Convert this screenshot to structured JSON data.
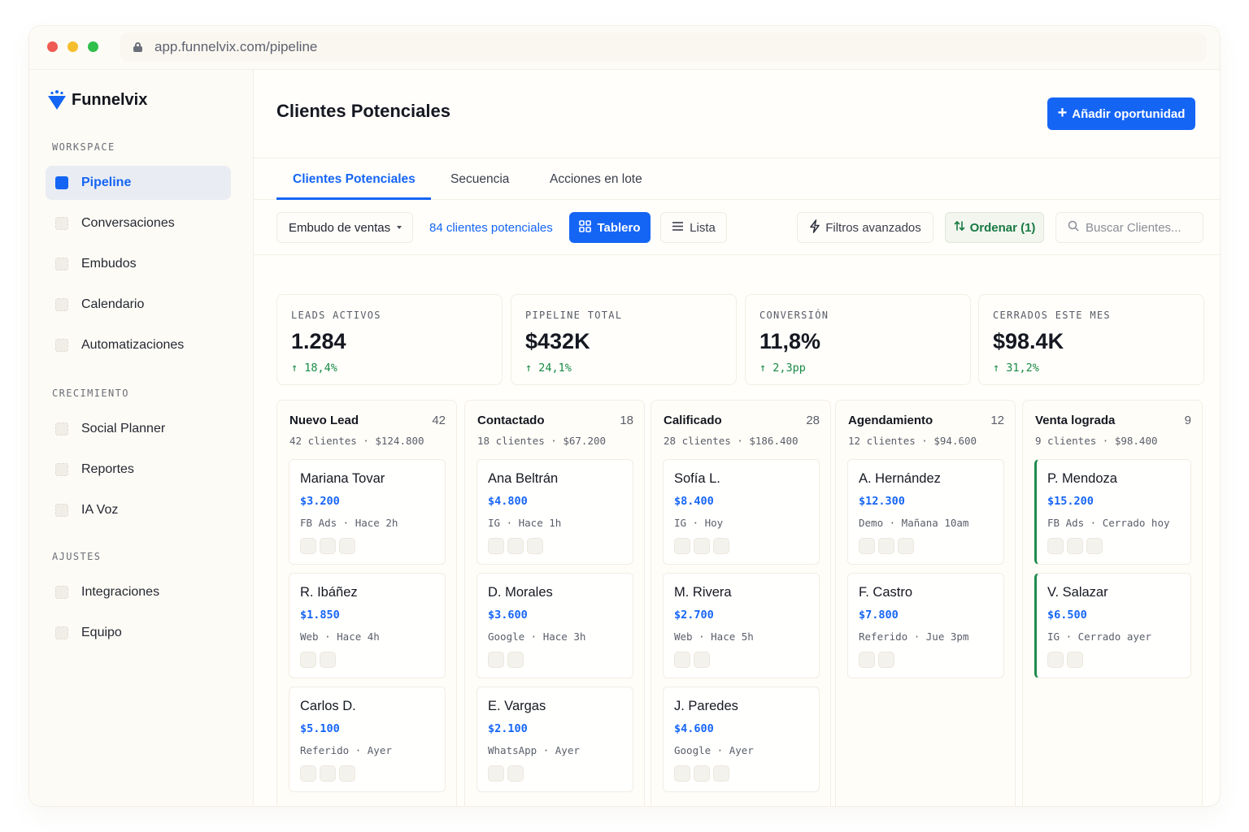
{
  "browser": {
    "url": "app.funnelvix.com/pipeline"
  },
  "brand": {
    "name": "Funnelvix",
    "color": "#1565f5"
  },
  "sidebar": {
    "sections": [
      {
        "label": "WORKSPACE",
        "items": [
          {
            "label": "Pipeline",
            "icon": "pipeline-icon",
            "active": true
          },
          {
            "label": "Conversaciones",
            "icon": "chat-icon"
          },
          {
            "label": "Embudos",
            "icon": "funnel-icon"
          },
          {
            "label": "Calendario",
            "icon": "calendar-icon"
          },
          {
            "label": "Automatizaciones",
            "icon": "automation-icon"
          }
        ]
      },
      {
        "label": "CRECIMIENTO",
        "items": [
          {
            "label": "Social Planner",
            "icon": "social-icon"
          },
          {
            "label": "Reportes",
            "icon": "reports-icon"
          },
          {
            "label": "IA Voz",
            "icon": "voice-icon"
          }
        ]
      },
      {
        "label": "AJUSTES",
        "items": [
          {
            "label": "Integraciones",
            "icon": "integrations-icon"
          },
          {
            "label": "Equipo",
            "icon": "team-icon"
          }
        ]
      }
    ]
  },
  "header": {
    "title": "Clientes Potenciales",
    "add_button": "Añadir oportunidad"
  },
  "tabs": [
    {
      "label": "Clientes Potenciales",
      "active": true
    },
    {
      "label": "Secuencia"
    },
    {
      "label": "Acciones en lote"
    }
  ],
  "toolbar": {
    "pipeline_select": "Embudo de ventas",
    "lead_count": "84 clientes potenciales",
    "board_label": "Tablero",
    "list_label": "Lista",
    "filters_label": "Filtros avanzados",
    "sort_label": "Ordenar (1)",
    "search_placeholder": "Buscar Clientes..."
  },
  "kpis": [
    {
      "label": "LEADS ACTIVOS",
      "value": "1.284",
      "delta": "18,4%"
    },
    {
      "label": "PIPELINE TOTAL",
      "value": "$432K",
      "delta": "24,1%"
    },
    {
      "label": "CONVERSIÓN",
      "value": "11,8%",
      "delta": "2,3pp"
    },
    {
      "label": "CERRADOS ESTE MES",
      "value": "$98.4K",
      "delta": "31,2%"
    }
  ],
  "columns": [
    {
      "title": "Nuevo Lead",
      "count": "42",
      "summary": "42 clientes · $124.800",
      "cards": [
        {
          "name": "Mariana Tovar",
          "amount": "$3.200",
          "meta": "FB Ads · Hace 2h",
          "chips": 3
        },
        {
          "name": "R. Ibáñez",
          "amount": "$1.850",
          "meta": "Web · Hace 4h",
          "chips": 2
        },
        {
          "name": "Carlos D.",
          "amount": "$5.100",
          "meta": "Referido · Ayer",
          "chips": 3
        }
      ]
    },
    {
      "title": "Contactado",
      "count": "18",
      "summary": "18 clientes · $67.200",
      "cards": [
        {
          "name": "Ana Beltrán",
          "amount": "$4.800",
          "meta": "IG · Hace 1h",
          "chips": 3
        },
        {
          "name": "D. Morales",
          "amount": "$3.600",
          "meta": "Google · Hace 3h",
          "chips": 2
        },
        {
          "name": "E. Vargas",
          "amount": "$2.100",
          "meta": "WhatsApp · Ayer",
          "chips": 2
        }
      ]
    },
    {
      "title": "Calificado",
      "count": "28",
      "summary": "28 clientes · $186.400",
      "cards": [
        {
          "name": "Sofía L.",
          "amount": "$8.400",
          "meta": "IG · Hoy",
          "chips": 3
        },
        {
          "name": "M. Rivera",
          "amount": "$2.700",
          "meta": "Web · Hace 5h",
          "chips": 2
        },
        {
          "name": "J. Paredes",
          "amount": "$4.600",
          "meta": "Google · Ayer",
          "chips": 3
        }
      ]
    },
    {
      "title": "Agendamiento",
      "count": "12",
      "summary": "12 clientes · $94.600",
      "cards": [
        {
          "name": "A. Hernández",
          "amount": "$12.300",
          "meta": "Demo · Mañana 10am",
          "chips": 3
        },
        {
          "name": "F. Castro",
          "amount": "$7.800",
          "meta": "Referido · Jue 3pm",
          "chips": 2
        }
      ]
    },
    {
      "title": "Venta lograda",
      "count": "9",
      "summary": "9 clientes · $98.400",
      "won": true,
      "cards": [
        {
          "name": "P. Mendoza",
          "amount": "$15.200",
          "meta": "FB Ads · Cerrado hoy",
          "chips": 3
        },
        {
          "name": "V. Salazar",
          "amount": "$6.500",
          "meta": "IG · Cerrado ayer",
          "chips": 2
        }
      ]
    }
  ],
  "colors": {
    "accent": "#1565f5",
    "positive": "#178a46",
    "won_border": "#1f8b4c"
  }
}
